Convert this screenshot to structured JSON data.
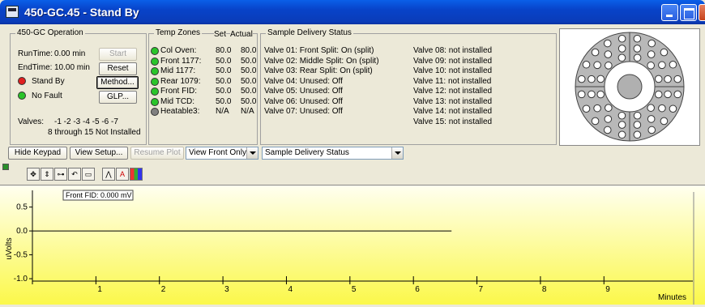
{
  "window": {
    "title": "450-GC.45 - Stand By"
  },
  "operation": {
    "legend": "450-GC Operation",
    "runtime_label": "RunTime:",
    "runtime_value": "0.00 min",
    "endtime_label": "EndTime:",
    "endtime_value": "10.00 min",
    "status1": "Stand By",
    "status1_color": "#e02020",
    "status2": "No Fault",
    "status2_color": "#2ac42a",
    "start_label": "Start",
    "reset_label": "Reset",
    "method_label": "Method...",
    "glp_label": "GLP...",
    "valves_label": "Valves:",
    "valves_value": "-1 -2 -3 -4 -5 -6 -7",
    "not_installed": "8 through 15 Not Installed"
  },
  "temp_zones": {
    "legend": "Temp Zones",
    "set_header": "Set",
    "actual_header": "Actual",
    "rows": [
      {
        "name": "Col Oven:",
        "set": "80.0",
        "actual": "80.0",
        "color": "#2ac42a"
      },
      {
        "name": "Front 1177:",
        "set": "50.0",
        "actual": "50.0",
        "color": "#2ac42a"
      },
      {
        "name": "Mid 1177:",
        "set": "50.0",
        "actual": "50.0",
        "color": "#2ac42a"
      },
      {
        "name": "Rear 1079:",
        "set": "50.0",
        "actual": "50.0",
        "color": "#2ac42a"
      },
      {
        "name": "Front FID:",
        "set": "50.0",
        "actual": "50.0",
        "color": "#2ac42a"
      },
      {
        "name": "Mid TCD:",
        "set": "50.0",
        "actual": "50.0",
        "color": "#2ac42a"
      },
      {
        "name": "Heatable3:",
        "set": "N/A",
        "actual": "N/A",
        "color": "#808080"
      }
    ]
  },
  "sample_delivery": {
    "legend": "Sample Delivery Status",
    "col1": [
      "Valve 01: Front Split: On (split)",
      "Valve 02: Middle Split: On (split)",
      "Valve 03: Rear Split: On (split)",
      "Valve 04: Unused: Off",
      "Valve 05: Unused: Off",
      "Valve 06: Unused: Off",
      "Valve 07: Unused: Off"
    ],
    "col2": [
      "Valve 08: not installed",
      "Valve 09: not installed",
      "Valve 10: not installed",
      "Valve 11: not installed",
      "Valve 12: not installed",
      "Valve 13: not installed",
      "Valve 14: not installed",
      "Valve 15: not installed"
    ]
  },
  "bottom_bar": {
    "hide_keypad": "Hide Keypad",
    "view_setup": "View Setup...",
    "resume_plot": "Resume Plot",
    "view_select": "View Front Only",
    "status_select": "Sample Delivery Status"
  },
  "toolbar_icons": [
    "move-icon",
    "zoom-icon",
    "pan-icon",
    "undo-icon",
    "window-icon",
    "peak-icon",
    "annotate-icon",
    "color-grid-icon"
  ],
  "chart_data": {
    "type": "line",
    "ylabel": "uVolts",
    "xlabel": "Minutes",
    "annotation": "Front FID: 0.000 mV",
    "x_ticks": [
      "1",
      "2",
      "3",
      "4",
      "5",
      "6",
      "7",
      "8",
      "9"
    ],
    "y_ticks": [
      "0.5",
      "0.0",
      "-0.5",
      "-1.0"
    ],
    "xlim": [
      0,
      10.4
    ],
    "ylim": [
      -1.05,
      0.85
    ],
    "series": [
      {
        "x": [
          0,
          6.6
        ],
        "y": [
          0.0,
          0.0
        ]
      }
    ],
    "background": "#fbf84a",
    "background_top": "#fffff0"
  }
}
